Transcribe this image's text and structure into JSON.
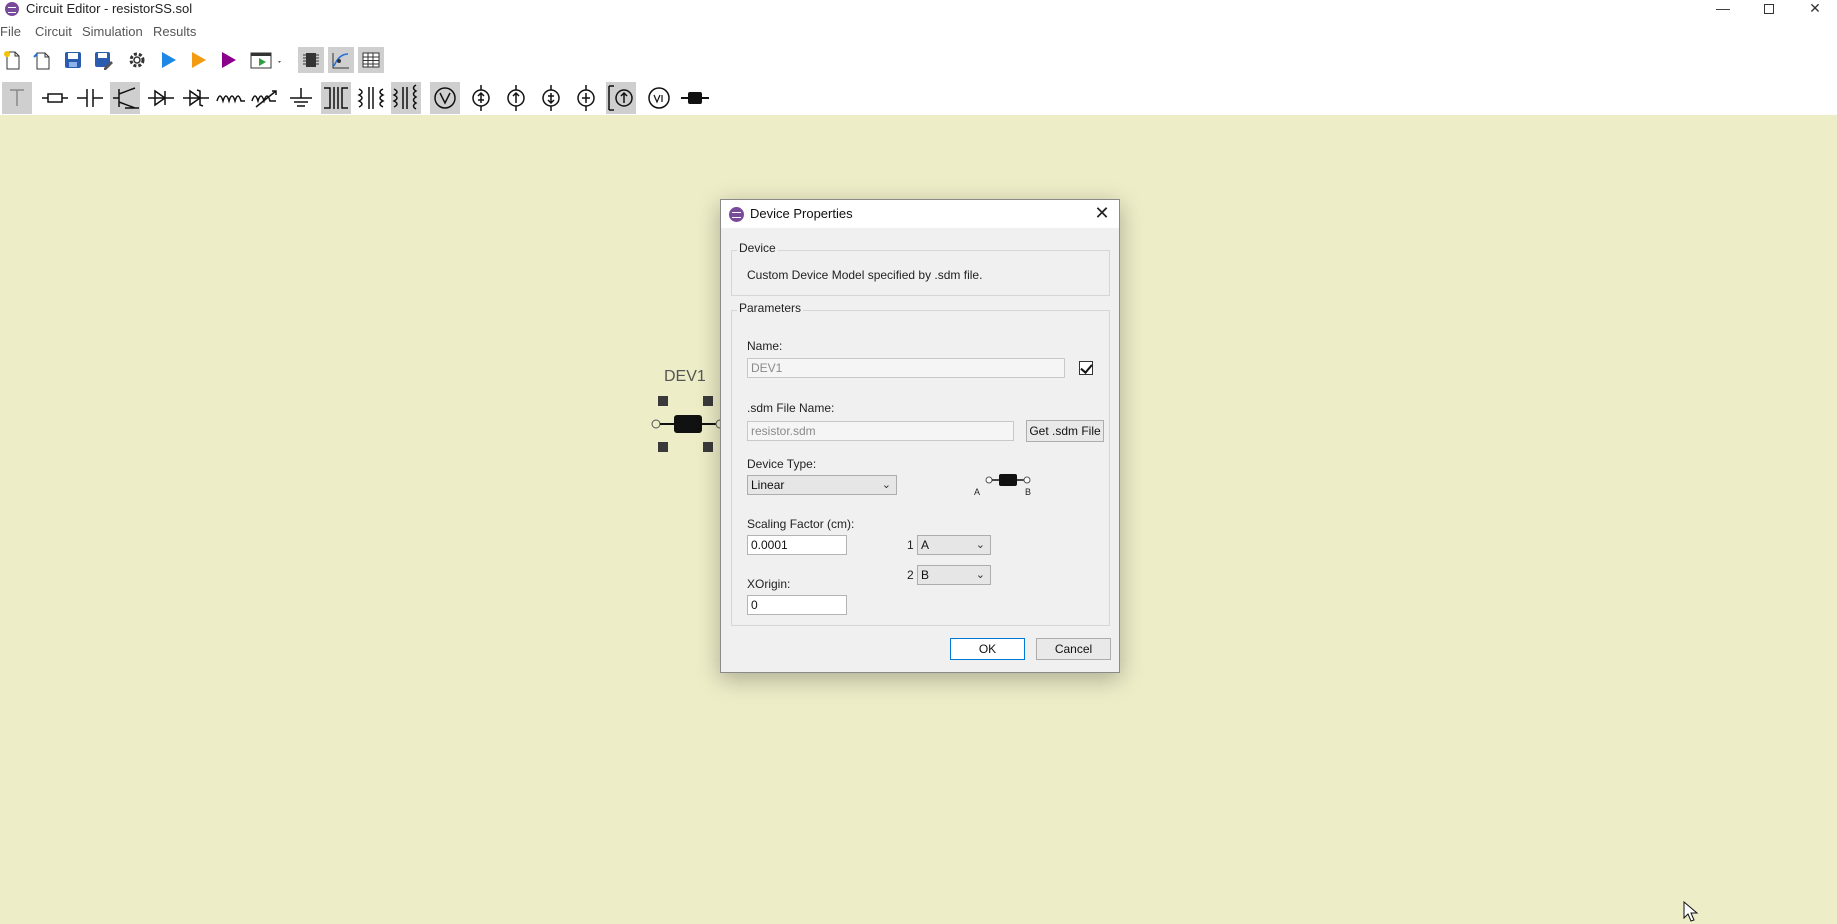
{
  "window": {
    "title": "Circuit Editor - resistorSS.sol",
    "minimize": "—",
    "close": "✕"
  },
  "menu": [
    "File",
    "Circuit",
    "Simulation",
    "Results"
  ],
  "toolbar_top": [
    "new-file",
    "open-file",
    "save",
    "save-as",
    "settings",
    "run",
    "run-orange",
    "run-purple",
    "output-dropdown",
    "chip",
    "sweep",
    "table"
  ],
  "toolbar_components": [
    "text-tool",
    "resistor",
    "capacitor",
    "transistor",
    "diode",
    "zener-diode",
    "inductor",
    "variable-resistor",
    "ground",
    "transformer",
    "transformer-alt",
    "transformer-tapped",
    "voltmeter",
    "current-source-1",
    "current-source-2",
    "current-source-3",
    "current-source-4",
    "dependent-source",
    "voltage-source",
    "custom-device"
  ],
  "canvas": {
    "device_label": "DEV1"
  },
  "dialog": {
    "title": "Device Properties",
    "close": "✕",
    "device_group": {
      "title": "Device",
      "description": "Custom Device Model specified by .sdm file."
    },
    "params_group": {
      "title": "Parameters",
      "name_label": "Name:",
      "name_value": "DEV1",
      "name_checked": true,
      "sdm_label": ".sdm File Name:",
      "sdm_value": "resistor.sdm",
      "get_sdm_button": "Get .sdm File",
      "device_type_label": "Device Type:",
      "device_type_value": "Linear",
      "scaling_label": "Scaling Factor (cm):",
      "scaling_value": "0.0001",
      "xorigin_label": "XOrigin:",
      "xorigin_value": "0",
      "pin1_index": "1",
      "pin1_value": "A",
      "pin2_index": "2",
      "pin2_value": "B",
      "symbol_pin_a": "A",
      "symbol_pin_b": "B"
    },
    "ok_button": "OK",
    "cancel_button": "Cancel"
  },
  "colors": {
    "canvas": "#ededc8",
    "run_blue": "#1e88e5",
    "run_orange": "#f39c12",
    "run_purple": "#8b008b",
    "accent_focus": "#0078d7"
  }
}
